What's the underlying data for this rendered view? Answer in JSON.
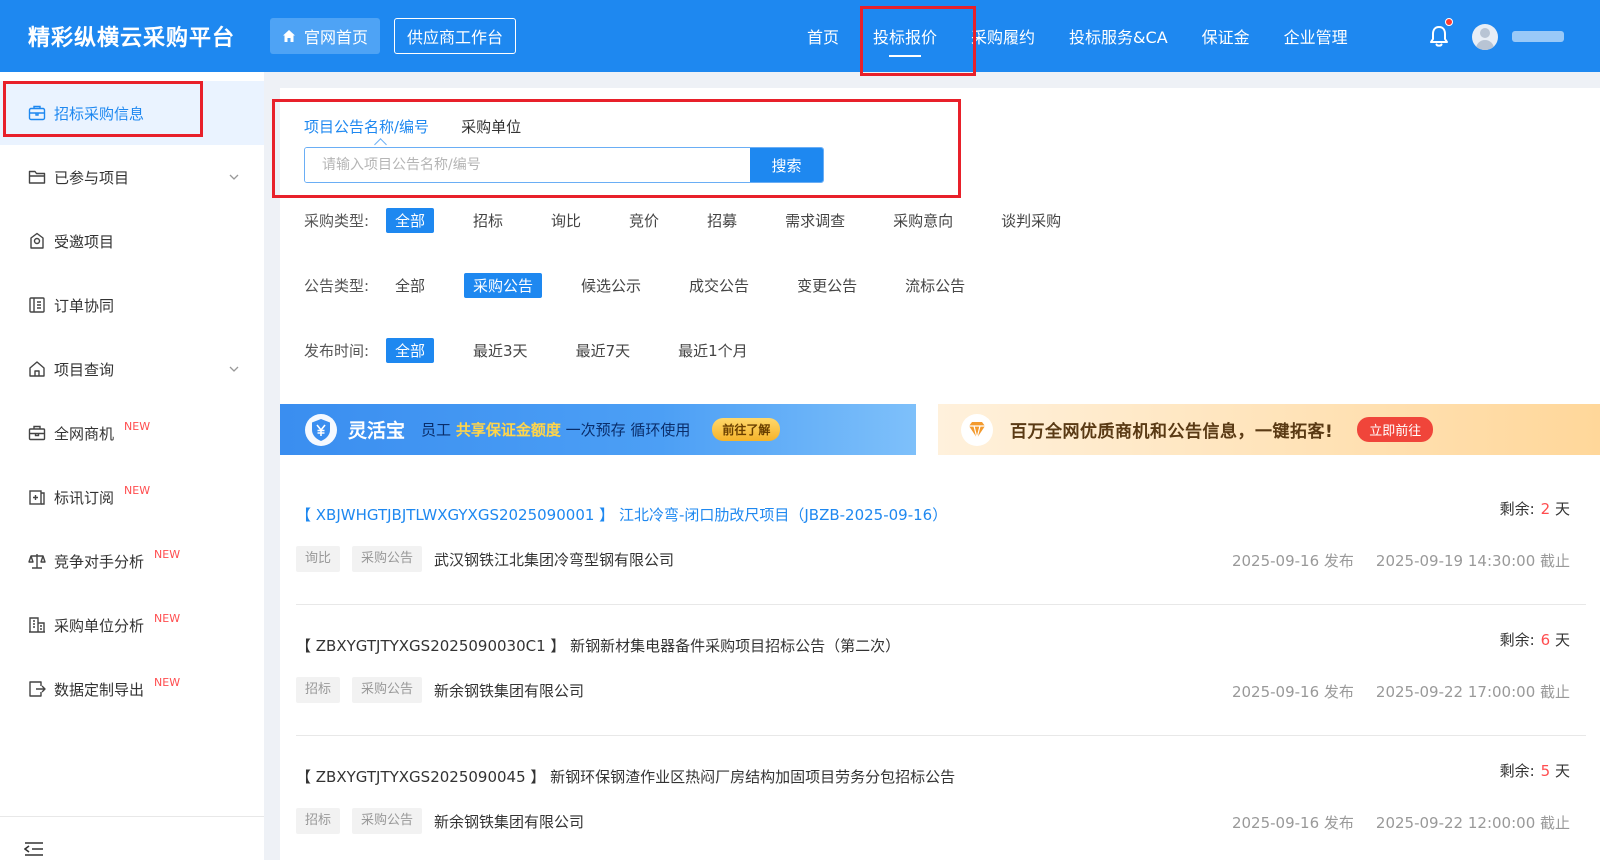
{
  "header": {
    "brand": "精彩纵横云采购平台",
    "home_button": "官网首页",
    "workbench_button": "供应商工作台",
    "nav": [
      "首页",
      "投标报价",
      "采购履约",
      "投标服务&CA",
      "保证金",
      "企业管理"
    ],
    "active_nav": "投标报价"
  },
  "sidebar": {
    "items": [
      {
        "label": "招标采购信息",
        "icon": "bid-list-icon"
      },
      {
        "label": "已参与项目",
        "icon": "folder-icon",
        "expandable": true
      },
      {
        "label": "受邀项目",
        "icon": "invite-icon"
      },
      {
        "label": "订单协同",
        "icon": "order-icon"
      },
      {
        "label": "项目查询",
        "icon": "home-icon",
        "expandable": true
      },
      {
        "label": "全网商机",
        "icon": "briefcase-icon",
        "badge": "NEW"
      },
      {
        "label": "标讯订阅",
        "icon": "subscribe-icon",
        "badge": "NEW"
      },
      {
        "label": "竞争对手分析",
        "icon": "balance-icon",
        "badge": "NEW"
      },
      {
        "label": "采购单位分析",
        "icon": "building-icon",
        "badge": "NEW"
      },
      {
        "label": "数据定制导出",
        "icon": "export-icon",
        "badge": "NEW"
      }
    ]
  },
  "search": {
    "tabs": [
      "项目公告名称/编号",
      "采购单位"
    ],
    "placeholder": "请输入项目公告名称/编号",
    "button": "搜索"
  },
  "filters": {
    "purchase_type": {
      "label": "采购类型:",
      "options": [
        "全部",
        "招标",
        "询比",
        "竞价",
        "招募",
        "需求调查",
        "采购意向",
        "谈判采购"
      ],
      "selected": "全部"
    },
    "notice_type": {
      "label": "公告类型:",
      "options": [
        "全部",
        "采购公告",
        "候选公示",
        "成交公告",
        "变更公告",
        "流标公告"
      ],
      "selected": "采购公告"
    },
    "publish_time": {
      "label": "发布时间:",
      "options": [
        "全部",
        "最近3天",
        "最近7天",
        "最近1个月"
      ],
      "selected": "全部"
    }
  },
  "banners": {
    "left": {
      "title": "灵活宝",
      "text_a": "员工",
      "highlight": "共享保证金额度",
      "text_b": "一次预存 循环使用",
      "button": "前往了解"
    },
    "right": {
      "text": "百万全网优质商机和公告信息，一键拓客!",
      "button": "立即前往"
    }
  },
  "listings": [
    {
      "title": "【 XBJWHGTJBJTLWXGYXGS2025090001 】 江北冷弯-闭口肋改尺项目（JBZB-2025-09-16）",
      "remain_label": "剩余:",
      "remain_num": "2",
      "remain_unit": "天",
      "tag1": "询比",
      "tag2": "采购公告",
      "company": "武汉钢铁江北集团冷弯型钢有限公司",
      "published": "2025-09-16 发布",
      "deadline": "2025-09-19 14:30:00 截止"
    },
    {
      "title": "【 ZBXYGTJTYXGS2025090030C1 】 新钢新材集电器备件采购项目招标公告（第二次）",
      "remain_label": "剩余:",
      "remain_num": "6",
      "remain_unit": "天",
      "tag1": "招标",
      "tag2": "采购公告",
      "company": "新余钢铁集团有限公司",
      "published": "2025-09-16 发布",
      "deadline": "2025-09-22 17:00:00 截止"
    },
    {
      "title": "【 ZBXYGTJTYXGS2025090045 】 新钢环保钢渣作业区热闷厂房结构加固项目劳务分包招标公告",
      "remain_label": "剩余:",
      "remain_num": "5",
      "remain_unit": "天",
      "tag1": "招标",
      "tag2": "采购公告",
      "company": "新余钢铁集团有限公司",
      "published": "2025-09-16 发布",
      "deadline": "2025-09-22 12:00:00 截止"
    }
  ]
}
